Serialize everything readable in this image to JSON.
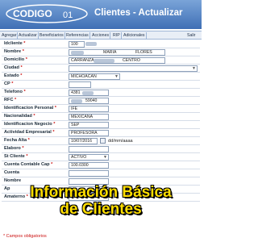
{
  "header": {
    "logo_text": "CODIGO",
    "logo_suffix": "01",
    "title": "Clientes - Actualizar"
  },
  "toolbar": [
    "Agregar",
    "Actualizar",
    "Beneficiarios",
    "Referencias",
    "Acciones",
    "RIP",
    "Adicionales",
    "Salir"
  ],
  "fields": {
    "idcliente": {
      "label": "Idcliente",
      "value": "100"
    },
    "nombre": {
      "label": "Nombre",
      "value1": "MARIA",
      "value2": "FLORES"
    },
    "domicilio": {
      "label": "Domicilio",
      "value1": "CARRANZA",
      "value2": "CENTRO"
    },
    "ciudad": {
      "label": "Ciudad",
      "value": ""
    },
    "estado": {
      "label": "Estado",
      "value": "MICHOACAN"
    },
    "cp": {
      "label": "CP",
      "value": ""
    },
    "telefono": {
      "label": "Telefono",
      "value": "4381"
    },
    "rfc": {
      "label": "RFC",
      "value": "59040"
    },
    "id_personal": {
      "label": "Identificacion Personal",
      "value": "IFE"
    },
    "nacionalidad": {
      "label": "Nacionalidad",
      "value": "MEXICANA"
    },
    "id_negocio": {
      "label": "Identificacion Negocio",
      "value": "SEP"
    },
    "actividad": {
      "label": "Actividad Empresarial",
      "value": "PROFESORA"
    },
    "fecha_alta": {
      "label": "Fecha Alta",
      "value": "10/07/2016",
      "hint": "dd/mm/aaaa"
    },
    "elaboro": {
      "label": "Elaboro",
      "value": ""
    },
    "st_cliente": {
      "label": "St Cliente",
      "value": "ACTIVO"
    },
    "cuenta_cap": {
      "label": "Cuenta Contable Cap",
      "value": "100.0300"
    },
    "cuenta_int": {
      "label": "Cuenta",
      "value": ""
    },
    "nombre2": {
      "label": "Nombre",
      "value": ""
    },
    "apellido": {
      "label": "Ap",
      "value": ""
    },
    "amaterno": {
      "label": "Amaterno",
      "value": ""
    }
  },
  "overlay": {
    "line1": "Información Básica",
    "line2": "de Clientes"
  },
  "footnote": "* Campos obligatorios",
  "colors": {
    "header": "#3f6fb5",
    "overlay_text": "#ffde00",
    "required": "#cc1111"
  }
}
